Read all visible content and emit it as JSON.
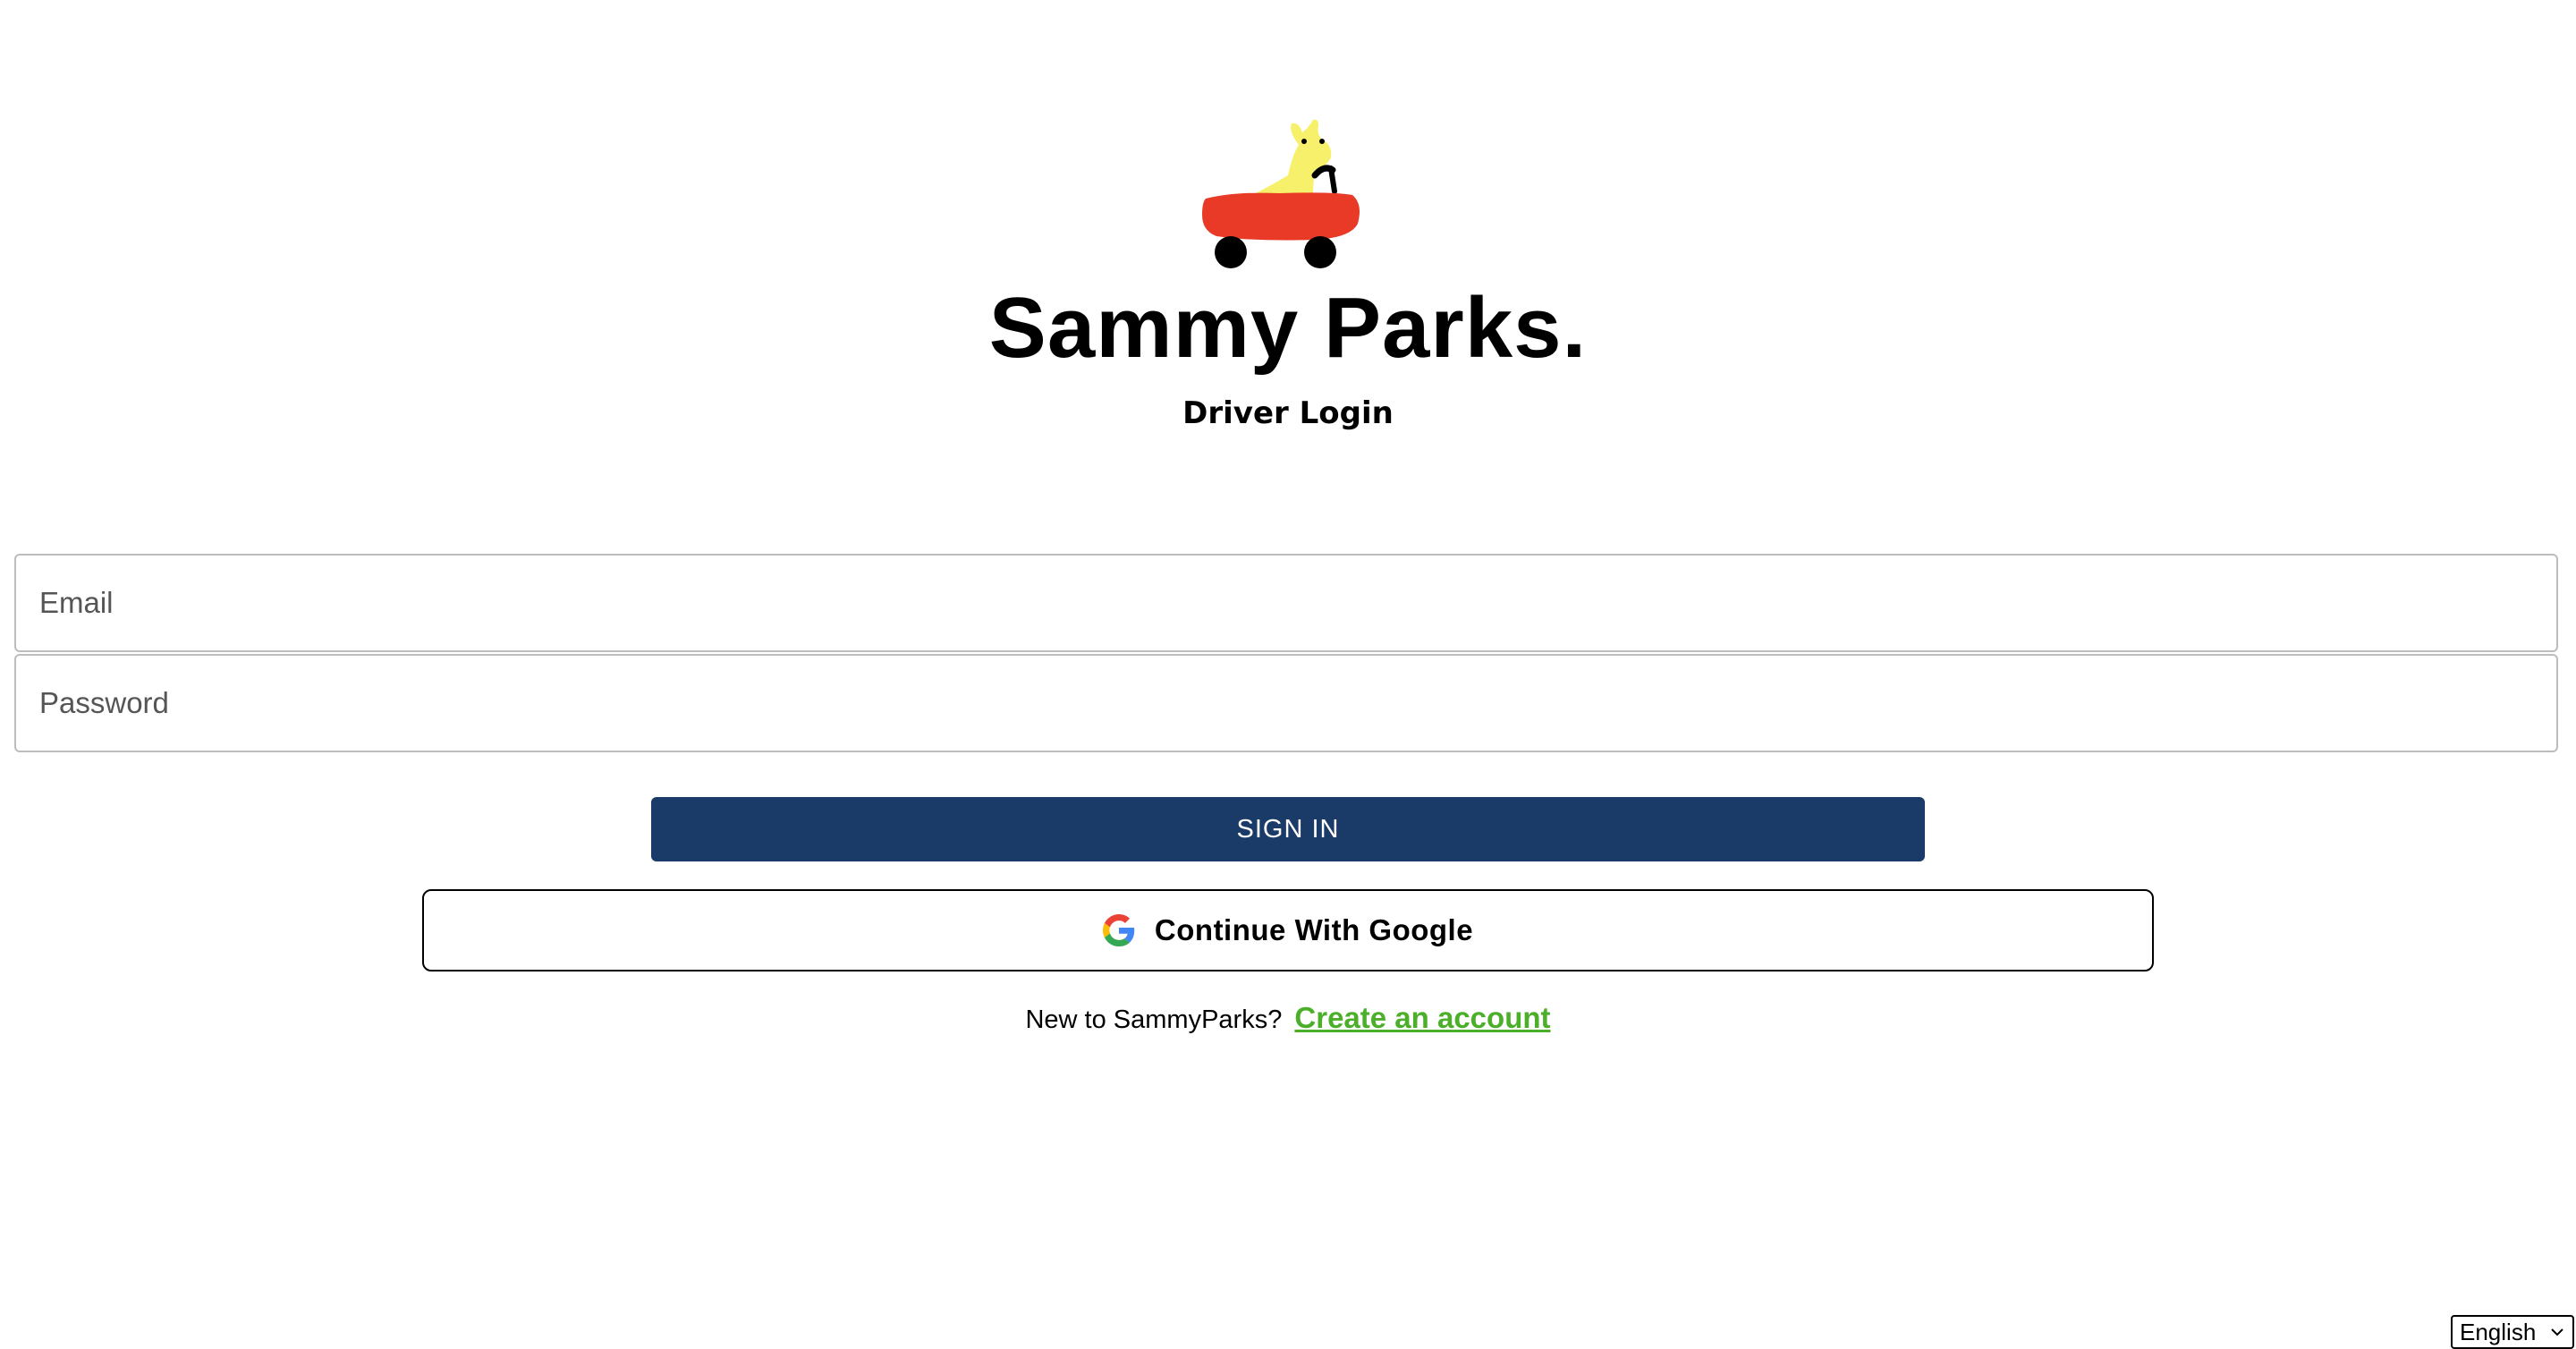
{
  "brand": {
    "title": "Sammy Parks.",
    "subtitle": "Driver Login",
    "logo_icon": "kangaroo-in-red-car-icon"
  },
  "form": {
    "email_placeholder": "Email",
    "password_placeholder": "Password",
    "email_value": "",
    "password_value": ""
  },
  "actions": {
    "signin_label": "SIGN IN",
    "google_label": "Continue With Google",
    "google_icon": "google-icon"
  },
  "signup": {
    "prompt": "New to SammyParks?",
    "link_label": "Create an account"
  },
  "language": {
    "selected": "English"
  },
  "colors": {
    "signin_bg": "#1a3a68",
    "link": "#4caf2a",
    "car": "#e83a26",
    "kangaroo": "#f7f06a"
  }
}
